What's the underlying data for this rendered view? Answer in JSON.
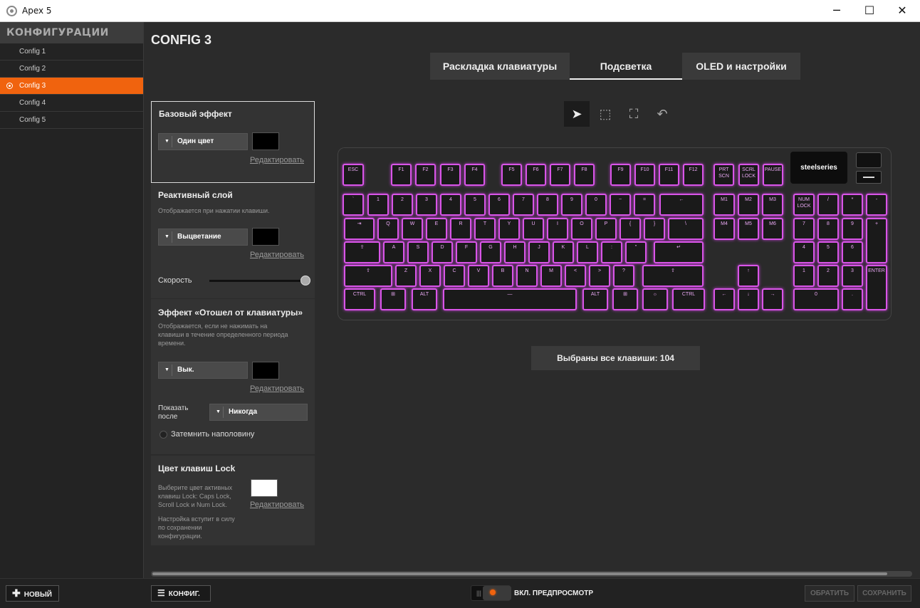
{
  "window": {
    "title": "Apex 5",
    "minimize": "─",
    "maximize": "☐",
    "close": "✕"
  },
  "sidebar": {
    "header": "КОНФИГУРАЦИИ",
    "configs": [
      {
        "label": "Config 1",
        "active": false
      },
      {
        "label": "Config 2",
        "active": false
      },
      {
        "label": "Config 3",
        "active": true
      },
      {
        "label": "Config 4",
        "active": false
      },
      {
        "label": "Config 5",
        "active": false
      }
    ],
    "new_button": "НОВЫЙ"
  },
  "page_title": "CONFIG 3",
  "tabs": [
    {
      "label": "Раскладка клавиатуры",
      "active": false
    },
    {
      "label": "Подсветка",
      "active": true
    },
    {
      "label": "OLED и настройки",
      "active": false
    }
  ],
  "base_effect": {
    "title": "Базовый эффект",
    "value": "Один цвет",
    "color": "#000000",
    "edit": "Редактировать"
  },
  "reactive": {
    "title": "Реактивный слой",
    "desc": "Отображается при нажатии клавиши.",
    "value": "Выцветание",
    "color": "#000000",
    "edit": "Редактировать",
    "speed_label": "Скорость",
    "speed_value": 1.0
  },
  "away": {
    "title": "Эффект «Отошел от клавиатуры»",
    "desc1": "Отображается, если не нажимать на",
    "desc2": "клавиши в течение определенного периода",
    "desc3": "времени.",
    "value": "Вык.",
    "color": "#000000",
    "edit": "Редактировать",
    "show_after_1": "Показать",
    "show_after_2": "после",
    "show_after_value": "Никогда",
    "dim_label": "Затемнить наполовину"
  },
  "lock_color": {
    "title": "Цвет клавиш Lock",
    "desc1": "Выберите цвет активных",
    "desc2": "клавиш Lock: Caps Lock,",
    "desc3": "Scroll Lock и Num Lock.",
    "note1": "Настройка вступит в силу",
    "note2": "по сохранении",
    "note3": "конфигурации.",
    "color": "#ffffff",
    "edit": "Редактировать"
  },
  "status": "Выбраны все клавиши: 104",
  "brand": "steelseries",
  "bottom": {
    "config_button": "КОНФИГ.",
    "preview_label": "ВКЛ. ПРЕДПРОСМОТР",
    "apply": "ОБРАТИТЬ",
    "save": "СОХРАНИТЬ"
  },
  "tools": [
    {
      "name": "pointer-tool-icon",
      "glyph": "➤",
      "active": true
    },
    {
      "name": "select-rectangle-icon",
      "glyph": "⬚",
      "active": false
    },
    {
      "name": "select-all-icon",
      "glyph": "⛶",
      "active": false
    },
    {
      "name": "undo-icon",
      "glyph": "↶",
      "active": false
    }
  ],
  "keys": {
    "row_fn": [
      "ESC",
      "F1",
      "F2",
      "F3",
      "F4",
      "F5",
      "F6",
      "F7",
      "F8",
      "F9",
      "F10",
      "F11",
      "F12",
      "PRT SCN",
      "SCRL LOCK",
      "PAUSE"
    ],
    "row_num": [
      "`",
      "1",
      "2",
      "3",
      "4",
      "5",
      "6",
      "7",
      "8",
      "9",
      "0",
      "−",
      "=",
      "←",
      "M1",
      "M2",
      "M3",
      "NUM LOCK",
      "/",
      "*",
      "-"
    ],
    "row_q": [
      "⇥",
      "Q",
      "W",
      "E",
      "R",
      "T",
      "Y",
      "U",
      "I",
      "O",
      "P",
      "{",
      "}",
      "\\",
      "M4",
      "M5",
      "M6",
      "7",
      "8",
      "9",
      "+"
    ],
    "row_a": [
      "⇪",
      "A",
      "S",
      "D",
      "F",
      "G",
      "H",
      "J",
      "K",
      "L",
      ":",
      "\"",
      "↵",
      "4",
      "5",
      "6"
    ],
    "row_z": [
      "⇧",
      "Z",
      "X",
      "C",
      "V",
      "B",
      "N",
      "M",
      "<",
      ">",
      "?",
      "⇧",
      "↑",
      "1",
      "2",
      "3",
      "ENTER"
    ],
    "row_ctrl": [
      "CTRL",
      "⊞",
      "ALT",
      "—",
      "ALT",
      "⊞",
      "☼",
      "CTRL",
      "←",
      "↓",
      "→",
      "0",
      "."
    ]
  },
  "accent": "#f0630e",
  "key_glow": "#d955e8"
}
